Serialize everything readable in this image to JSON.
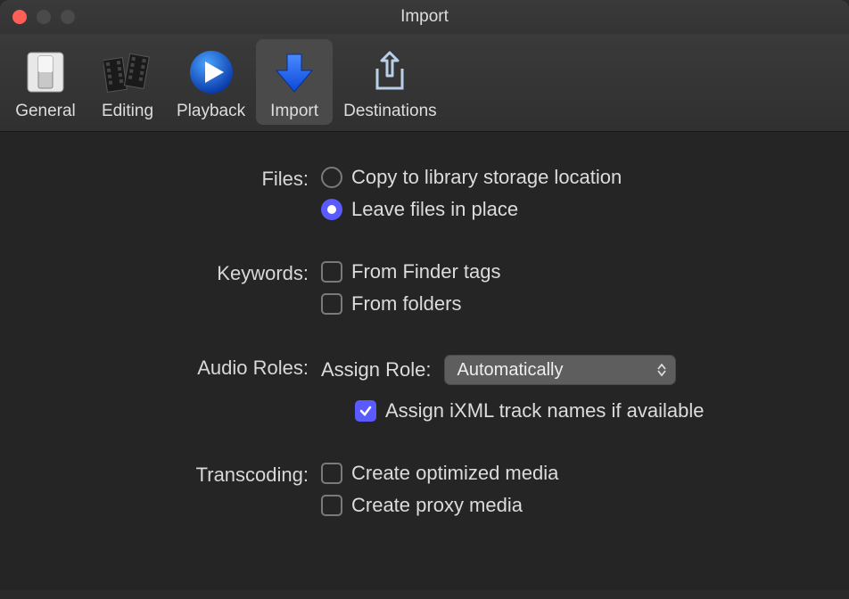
{
  "window": {
    "title": "Import"
  },
  "toolbar": {
    "items": [
      {
        "label": "General"
      },
      {
        "label": "Editing"
      },
      {
        "label": "Playback"
      },
      {
        "label": "Import"
      },
      {
        "label": "Destinations"
      }
    ],
    "active": "Import"
  },
  "form": {
    "files": {
      "label": "Files:",
      "option_copy": "Copy to library storage location",
      "option_leave": "Leave files in place",
      "selected": "leave"
    },
    "keywords": {
      "label": "Keywords:",
      "from_finder_tags": {
        "label": "From Finder tags",
        "checked": false
      },
      "from_folders": {
        "label": "From folders",
        "checked": false
      }
    },
    "audio_roles": {
      "label": "Audio Roles:",
      "assign_label": "Assign Role:",
      "select_value": "Automatically",
      "assign_ixml": {
        "label": "Assign iXML track names if available",
        "checked": true
      }
    },
    "transcoding": {
      "label": "Transcoding:",
      "optimized": {
        "label": "Create optimized media",
        "checked": false
      },
      "proxy": {
        "label": "Create proxy media",
        "checked": false
      }
    }
  }
}
